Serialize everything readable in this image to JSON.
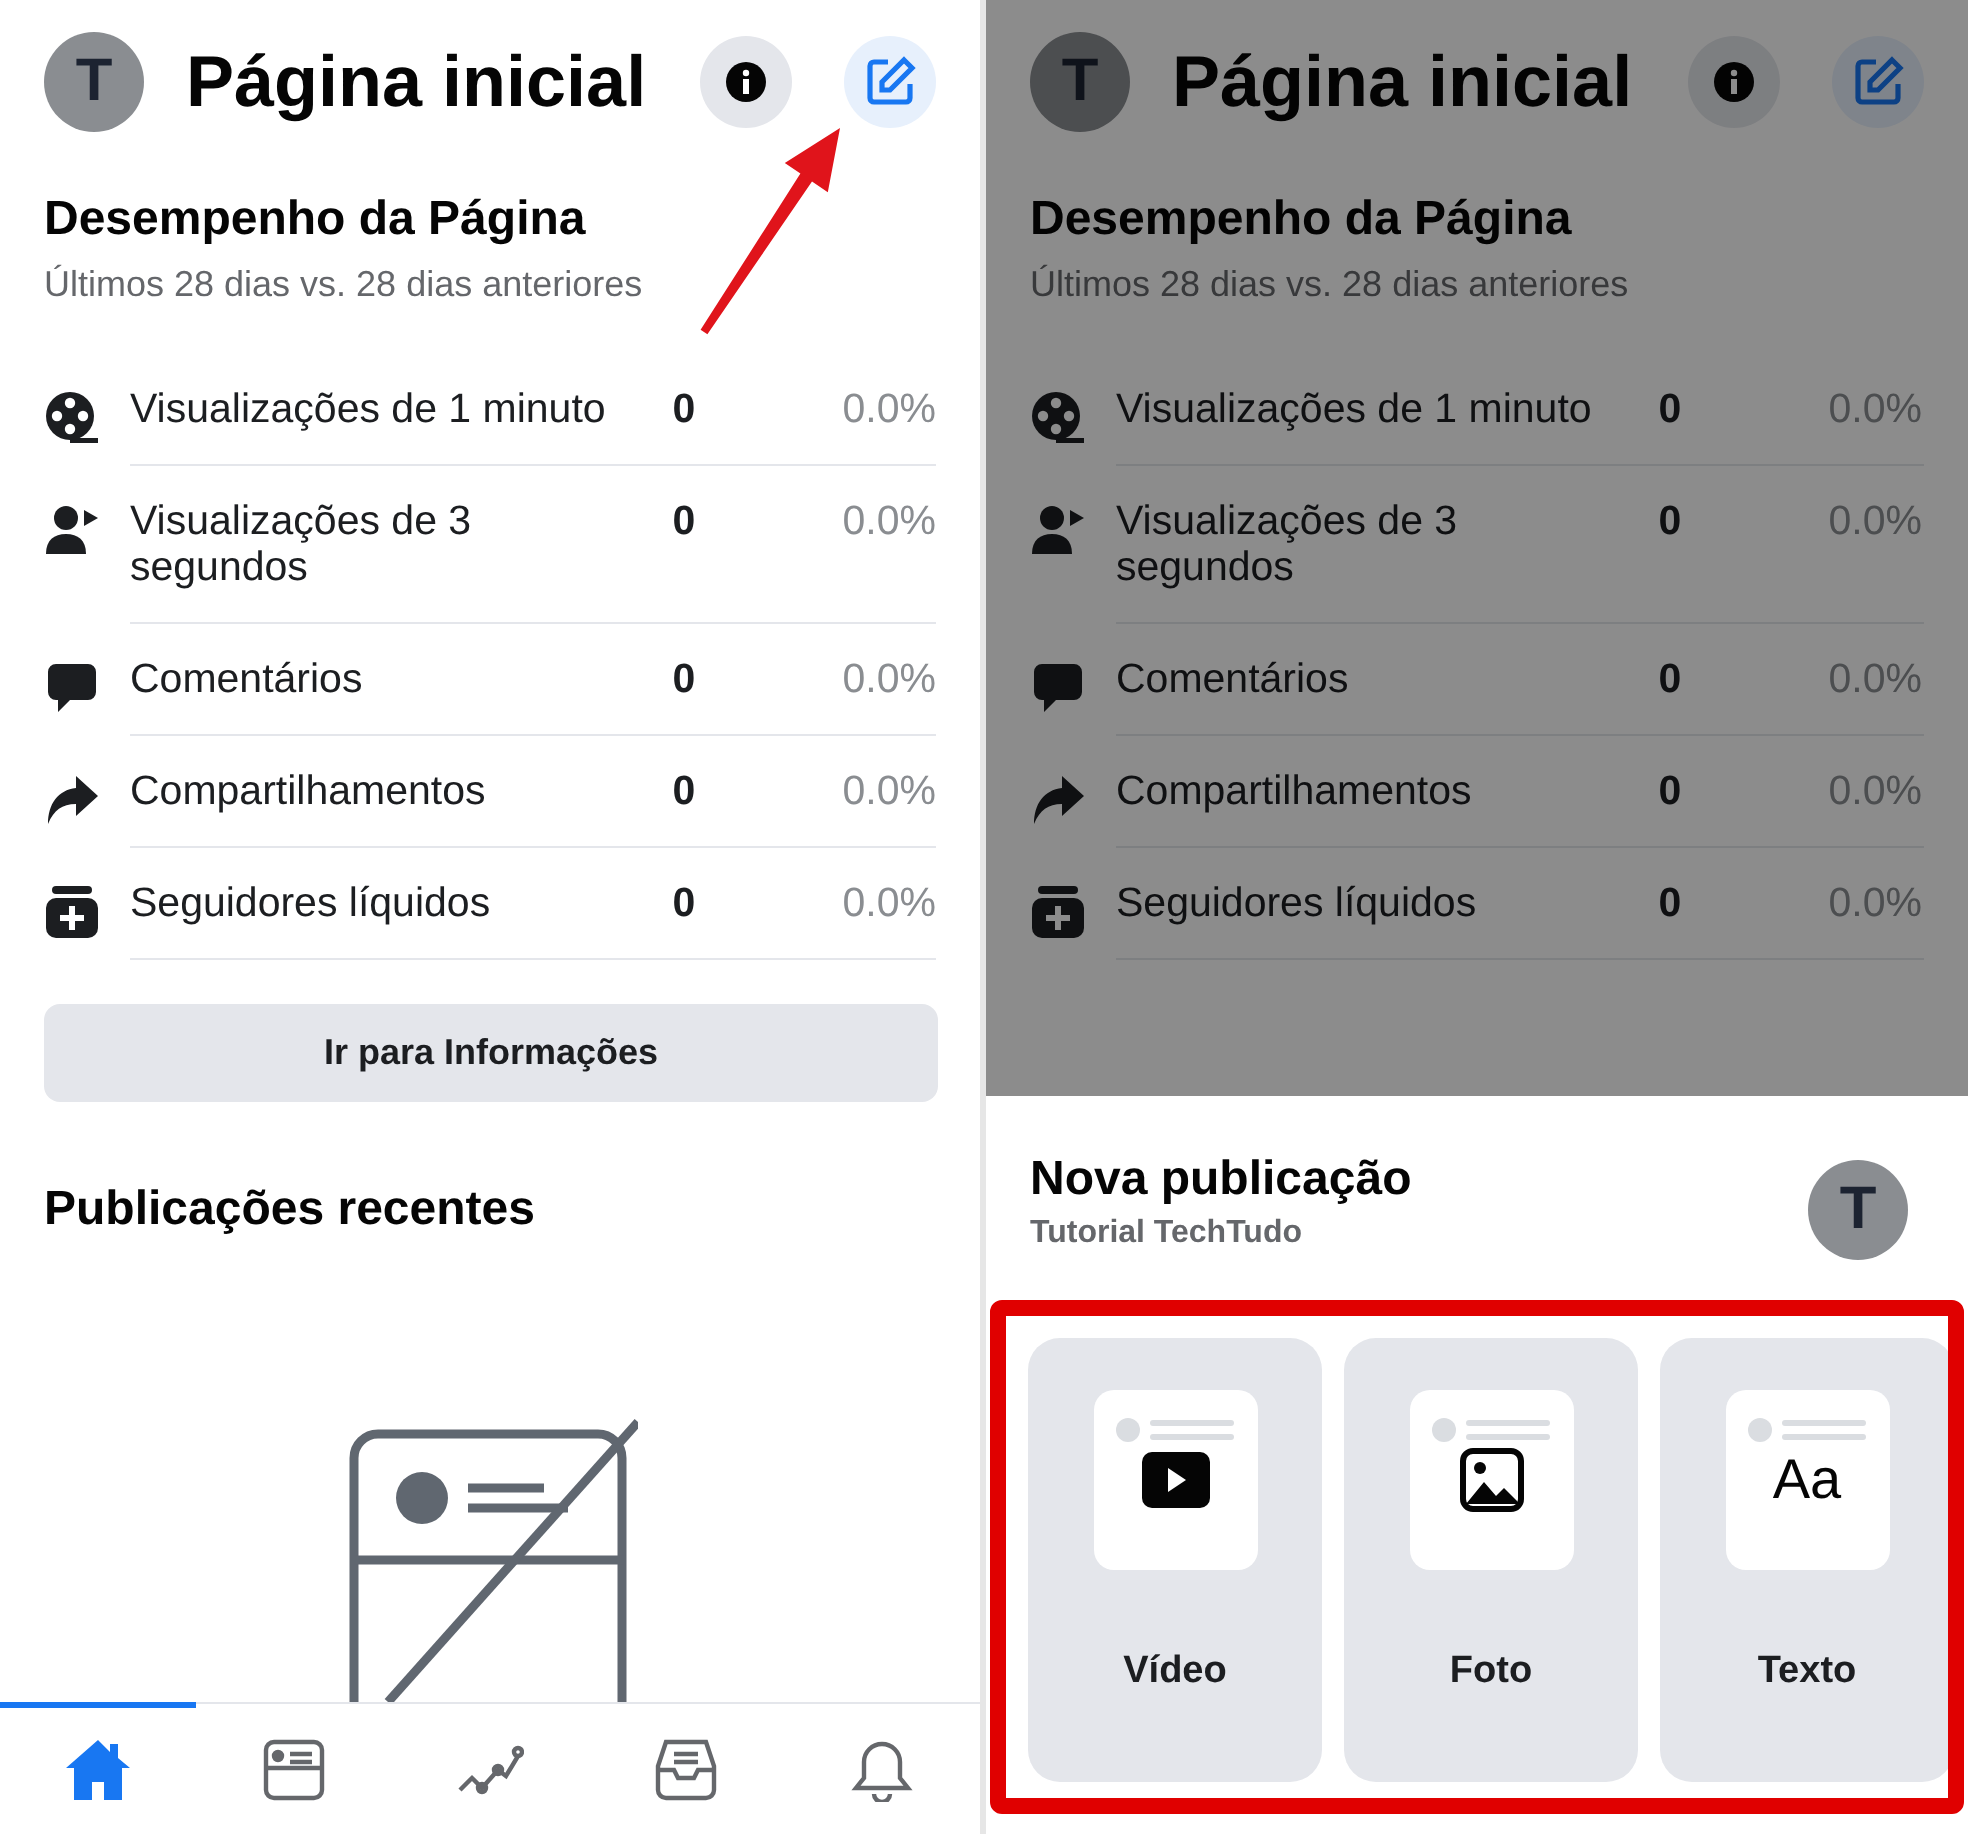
{
  "screens": [
    {
      "avatar_letter": "T",
      "title": "Página inicial",
      "dimmed": false,
      "performance": {
        "title": "Desempenho da Página",
        "subtitle": "Últimos 28 dias vs. 28 dias anteriores",
        "metrics": [
          {
            "kind": "film",
            "label": "Visualizações de 1 minuto",
            "value": "0",
            "change": "0.0%"
          },
          {
            "kind": "viewer",
            "label": "Visualizações de 3 segundos",
            "value": "0",
            "change": "0.0%"
          },
          {
            "kind": "comment",
            "label": "Comentários",
            "value": "0",
            "change": "0.0%"
          },
          {
            "kind": "share",
            "label": "Compartilhamentos",
            "value": "0",
            "change": "0.0%"
          },
          {
            "kind": "followers",
            "label": "Seguidores líquidos",
            "value": "0",
            "change": "0.0%"
          }
        ]
      },
      "insights_button": "Ir para Informações",
      "recent_title": "Publicações recentes",
      "nav": [
        {
          "kind": "home",
          "selected": true
        },
        {
          "kind": "feed",
          "selected": false
        },
        {
          "kind": "chart",
          "selected": false
        },
        {
          "kind": "inbox",
          "selected": false
        },
        {
          "kind": "bell",
          "selected": false
        }
      ]
    },
    {
      "avatar_letter": "T",
      "title": "Página inicial",
      "dimmed": true,
      "performance": {
        "title": "Desempenho da Página",
        "subtitle": "Últimos 28 dias vs. 28 dias anteriores",
        "metrics": [
          {
            "kind": "film",
            "label": "Visualizações de 1 minuto",
            "value": "0",
            "change": "0.0%"
          },
          {
            "kind": "viewer",
            "label": "Visualizações de 3 segundos",
            "value": "0",
            "change": "0.0%"
          },
          {
            "kind": "comment",
            "label": "Comentários",
            "value": "0",
            "change": "0.0%"
          },
          {
            "kind": "share",
            "label": "Compartilhamentos",
            "value": "0",
            "change": "0.0%"
          },
          {
            "kind": "followers",
            "label": "Seguidores líquidos",
            "value": "0",
            "change": "0.0%"
          }
        ]
      },
      "sheet": {
        "title": "Nova publicação",
        "subtitle": "Tutorial TechTudo",
        "avatar_letter": "T",
        "options": [
          {
            "kind": "video",
            "label": "Vídeo"
          },
          {
            "kind": "photo",
            "label": "Foto"
          },
          {
            "kind": "text",
            "label": "Texto",
            "glyph": "Aa"
          }
        ]
      }
    }
  ]
}
